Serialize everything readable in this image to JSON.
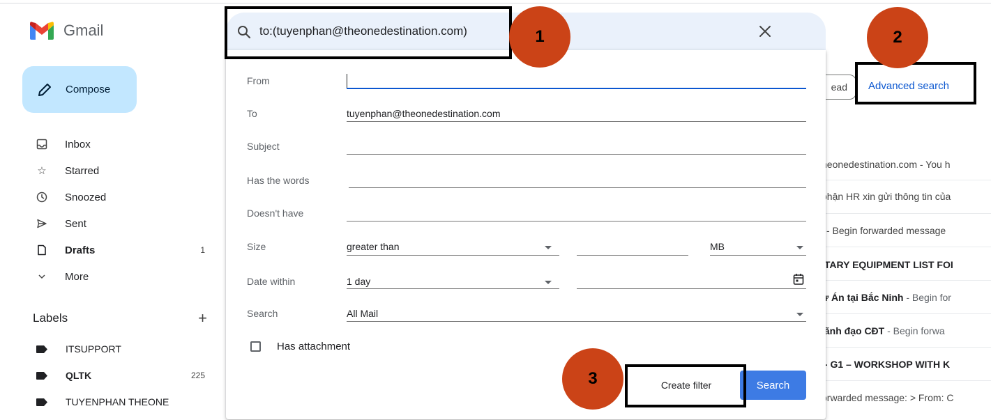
{
  "app": {
    "name": "Gmail",
    "logo_colors": [
      "#ea4335",
      "#4285f4",
      "#34a853",
      "#fbbc04",
      "#c5221f"
    ]
  },
  "sidebar": {
    "compose_label": "Compose",
    "nav": [
      {
        "label": "Inbox",
        "icon": "inbox-icon",
        "count": ""
      },
      {
        "label": "Starred",
        "icon": "star-icon",
        "count": ""
      },
      {
        "label": "Snoozed",
        "icon": "clock-icon",
        "count": ""
      },
      {
        "label": "Sent",
        "icon": "send-icon",
        "count": ""
      },
      {
        "label": "Drafts",
        "icon": "draft-icon",
        "count": "1"
      },
      {
        "label": "More",
        "icon": "chevron-down-icon",
        "count": ""
      }
    ],
    "labels_title": "Labels",
    "labels_add": "+",
    "labels": [
      {
        "label": "ITSUPPORT",
        "count": ""
      },
      {
        "label": "QLTK",
        "count": "225"
      },
      {
        "label": "TUYENPHAN THEONE",
        "count": ""
      }
    ]
  },
  "search": {
    "query": "to:(tuyenphan@theonedestination.com)"
  },
  "advanced": {
    "from_label": "From",
    "from_value": "",
    "to_label": "To",
    "to_value": "tuyenphan@theonedestination.com",
    "subject_label": "Subject",
    "subject_value": "",
    "has_words_label": "Has the words",
    "has_words_value": "",
    "doesnt_have_label": "Doesn't have",
    "doesnt_have_value": "",
    "size_label": "Size",
    "size_operator": "greater than",
    "size_value": "",
    "size_unit": "MB",
    "date_label": "Date within",
    "date_value": "1 day",
    "date_input": "",
    "search_in_label": "Search",
    "search_in_value": "All Mail",
    "has_attachment_label": "Has attachment",
    "has_attachment_checked": false,
    "create_filter_label": "Create filter",
    "search_button_label": "Search"
  },
  "background": {
    "mark_read_label": "ead",
    "advanced_search_link": "Advanced search",
    "rows": [
      {
        "sender": "",
        "text": "heonedestination.com - You h"
      },
      {
        "sender": "",
        "text": "phận HR xin gửi thông tin của"
      },
      {
        "sender": "",
        "text": "i - Begin forwarded message"
      },
      {
        "sender": "ITARY EQUIPMENT LIST FOI",
        "text": ""
      },
      {
        "sender": "ự Án tại Bắc Ninh",
        "text": " - Begin for"
      },
      {
        "sender": "lãnh đạo CĐT",
        "text": " - Begin forwa"
      },
      {
        "sender": "j- G1 – WORKSHOP WITH K",
        "text": ""
      },
      {
        "sender": "",
        "text": "orwarded message: > From: C"
      }
    ]
  },
  "annotations": {
    "badge_1": "1",
    "badge_2": "2",
    "badge_3": "3",
    "badge_color": "#cb4317"
  }
}
